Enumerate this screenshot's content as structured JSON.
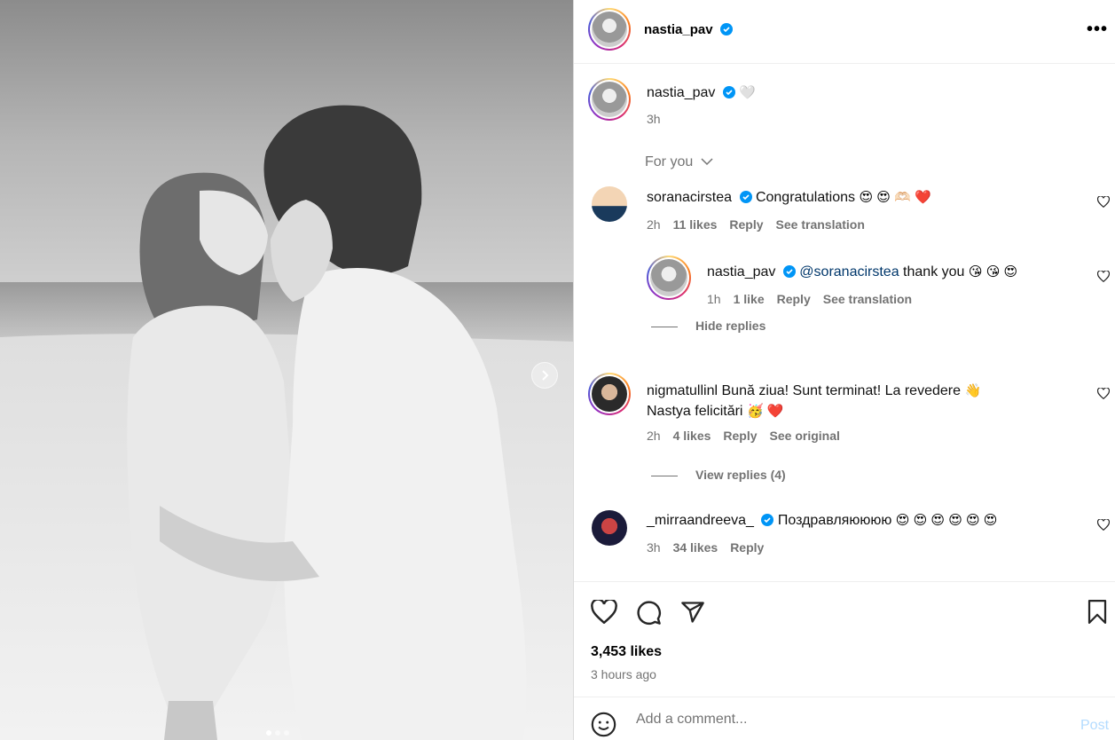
{
  "post": {
    "username": "nastia_pav",
    "caption_emoji": "🤍",
    "caption_time": "3h",
    "likes": "3,453 likes",
    "time_ago": "3 hours ago"
  },
  "filter": {
    "label": "For you"
  },
  "comments": [
    {
      "username": "soranacirstea",
      "text": "Congratulations",
      "emojis": "😍 😍 🫶🏻 ❤️",
      "time": "2h",
      "likes": "11 likes",
      "reply": "Reply",
      "translate": "See translation"
    },
    {
      "username": "nastia_pav",
      "mention": "@soranacirstea",
      "text": "thank you",
      "emojis": "😘 😘 😍",
      "time": "1h",
      "likes": "1 like",
      "reply": "Reply",
      "translate": "See translation",
      "hide_replies": "Hide replies"
    },
    {
      "username": "nigmatullinl",
      "text": "Bună ziua! Sunt terminat! La revedere",
      "emojis": "👋",
      "text2": "Nastya felicitări",
      "emojis2": "🥳 ❤️",
      "time": "2h",
      "likes": "4 likes",
      "reply": "Reply",
      "translate": "See original",
      "view_replies": "View replies (4)"
    },
    {
      "username": "_mirraandreeva_",
      "text": "Поздравляюююю",
      "emojis": "😍 😍 😍 😍 😍 😍",
      "time": "3h",
      "likes": "34 likes",
      "reply": "Reply"
    }
  ],
  "composer": {
    "placeholder": "Add a comment...",
    "post_label": "Post"
  },
  "colors": {
    "verified": "#0095f6",
    "secondary_text": "#737373",
    "post_disabled": "#b3dbff"
  }
}
